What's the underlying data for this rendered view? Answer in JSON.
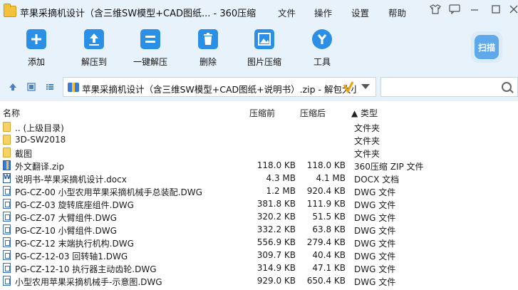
{
  "window": {
    "title": "苹果采摘机设计（含三维SW模型+CAD图纸... - 360压缩",
    "menu": [
      "文件",
      "操作",
      "设置",
      "帮助"
    ]
  },
  "toolbar": {
    "buttons": [
      {
        "label": "添加",
        "icon": "add-icon"
      },
      {
        "label": "解压到",
        "icon": "extract-icon"
      },
      {
        "label": "一键解压",
        "icon": "one-click-extract-icon"
      },
      {
        "label": "删除",
        "icon": "trash-icon"
      },
      {
        "label": "图片压缩",
        "icon": "image-compress-icon"
      },
      {
        "label": "工具",
        "icon": "tools-icon"
      }
    ],
    "scan_label": "扫描"
  },
  "address": {
    "path": "苹果采摘机设计（含三维SW模型+CAD图纸+说明书）.zip - 解包大小"
  },
  "columns": {
    "name": "名称",
    "before": "压缩前",
    "after": "压缩后",
    "type": "▲ 类型"
  },
  "files": [
    {
      "icon": "folder",
      "name": ".. (上级目录)",
      "before": "",
      "after": "",
      "type": "文件夹"
    },
    {
      "icon": "folder",
      "name": "3D-SW2018",
      "before": "",
      "after": "",
      "type": "文件夹"
    },
    {
      "icon": "folder",
      "name": "截图",
      "before": "",
      "after": "",
      "type": "文件夹"
    },
    {
      "icon": "zip",
      "name": "外文翻译.zip",
      "before": "118.0 KB",
      "after": "118.0 KB",
      "type": "360压缩 ZIP 文件"
    },
    {
      "icon": "docx",
      "name": "说明书-苹果采摘机设计.docx",
      "before": "4.3 MB",
      "after": "4.1 MB",
      "type": "DOCX 文档"
    },
    {
      "icon": "dwg",
      "name": "PG-CZ-00 小型农用苹果采摘机械手总装配.DWG",
      "before": "1.2 MB",
      "after": "920.4 KB",
      "type": "DWG 文件"
    },
    {
      "icon": "dwg",
      "name": "PG-CZ-03 旋转底座组件.DWG",
      "before": "381.8 KB",
      "after": "111.9 KB",
      "type": "DWG 文件"
    },
    {
      "icon": "dwg",
      "name": "PG-CZ-07 大臂组件.DWG",
      "before": "320.2 KB",
      "after": "51.5 KB",
      "type": "DWG 文件"
    },
    {
      "icon": "dwg",
      "name": "PG-CZ-10 小臂组件.DWG",
      "before": "332.2 KB",
      "after": "63.8 KB",
      "type": "DWG 文件"
    },
    {
      "icon": "dwg",
      "name": "PG-CZ-12 末端执行机构.DWG",
      "before": "556.9 KB",
      "after": "279.4 KB",
      "type": "DWG 文件"
    },
    {
      "icon": "dwg",
      "name": "PG-CZ-12-03 回转轴1.DWG",
      "before": "309.7 KB",
      "after": "40.4 KB",
      "type": "DWG 文件"
    },
    {
      "icon": "dwg",
      "name": "PG-CZ-12-10 执行器主动齿轮.DWG",
      "before": "314.9 KB",
      "after": "47.1 KB",
      "type": "DWG 文件"
    },
    {
      "icon": "dwg",
      "name": "小型农用苹果采摘机械手-示意图.DWG",
      "before": "929.0 KB",
      "after": "650.4 KB",
      "type": "DWG 文件"
    }
  ]
}
